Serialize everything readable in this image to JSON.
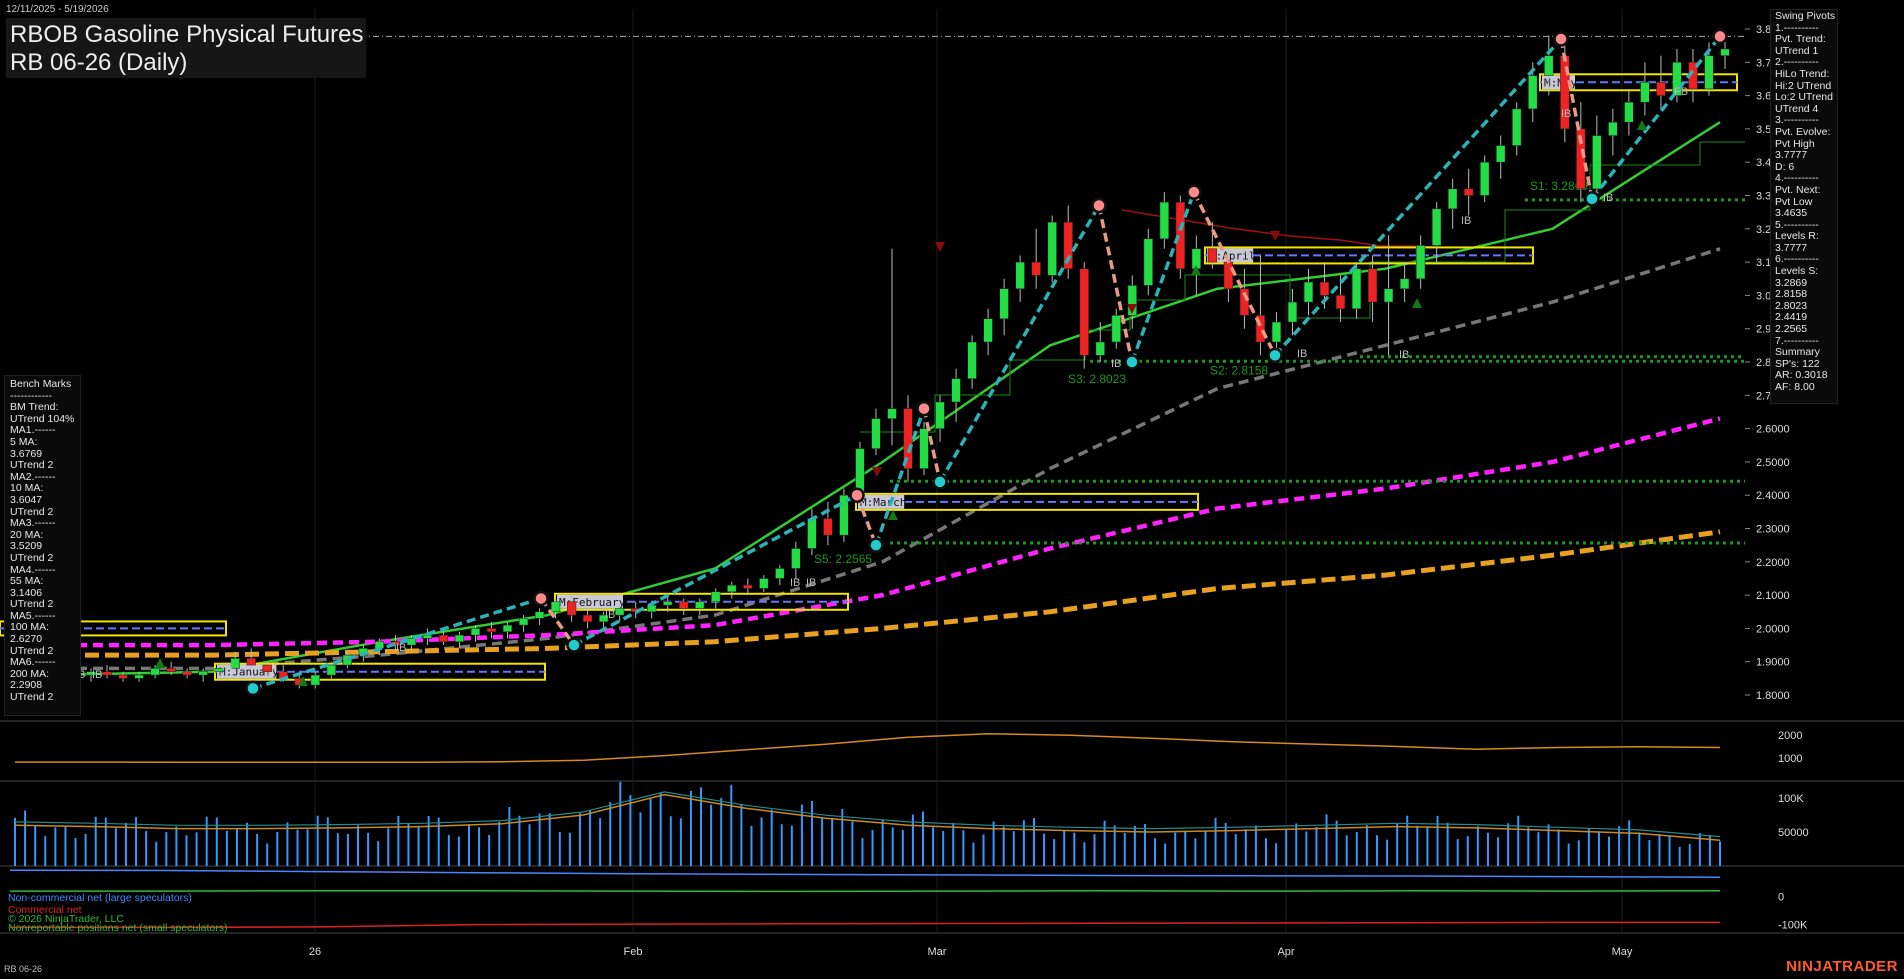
{
  "header": {
    "date_range": "12/11/2025 - 5/19/2026",
    "title": "RBOB Gasoline Physical Futures",
    "subtitle": "RB 06-26 (Daily)"
  },
  "benchmarks": [
    "Bench Marks",
    "------------",
    "BM Trend:",
    "UTrend 104%",
    "MA1.------",
    "5 MA:",
    "3.6769",
    "UTrend 2",
    "MA2.------",
    "10 MA:",
    "3.6047",
    "UTrend 2",
    "MA3.------",
    "20 MA:",
    "3.5209",
    "UTrend 2",
    "MA4.------",
    "55 MA:",
    "3.1406",
    "UTrend 2",
    "MA5.------",
    "100 MA:",
    "2.6270",
    "UTrend 2",
    "MA6.------",
    "200 MA:",
    "2.2908",
    "UTrend 2"
  ],
  "swing_pivots": [
    "Swing Pivots",
    "1.----------",
    "Pvt. Trend:",
    "UTrend 1",
    "2.----------",
    "HiLo Trend:",
    "Hi:2 UTrend",
    "Lo:2 UTrend",
    "UTrend 4",
    "3.----------",
    "Pvt. Evolve:",
    "Pvt High",
    "3.7777",
    "D: 6",
    "4.----------",
    "Pvt. Next:",
    "Pvt Low",
    "3.4635",
    "5.----------",
    "Levels R:",
    "3.7777",
    "6.----------",
    "Levels S:",
    "3.2869",
    "2.8158",
    "2.8023",
    "2.4419",
    "2.2565",
    "7.----------",
    "Summary",
    "SP's: 122",
    "AR: 0.3018",
    "AF: 8.00"
  ],
  "footer": {
    "symbol": "RB 06-26",
    "brand": "NINJATRADER",
    "cot_noncommercial": "Non-commercial net (large speculators)",
    "cot_commercial": "Commercial net",
    "cot_copyright": "© 2026 NinjaTrader, LLC",
    "cot_nonreportable": "Nonreportable positions net (small speculators)"
  },
  "colors": {
    "background": "#000000",
    "bull_candle": "#22dd44",
    "bear_candle": "#ee2222",
    "ma20": "#33cc33",
    "ma55": "#777777",
    "ma100": "#ff22ff",
    "ma200": "#e8a020",
    "swing_line_up": "#2ab3b8",
    "swing_line_down": "#e89a84",
    "support": "#1a9a1a",
    "volume": "#3399ff",
    "cot_noncommercial": "#4488ff",
    "cot_commercial": "#dd2222",
    "cot_nonreportable": "#33bb33",
    "brand": "#ff5a2a"
  },
  "chart_data": [
    {
      "type": "candlestick",
      "title": "RBOB Gasoline Physical Futures",
      "subtitle": "RB 06-26 (Daily)",
      "x_tick_labels": [
        "26",
        "Feb",
        "Mar",
        "Apr",
        "May"
      ],
      "y_tick_labels": [
        "3.8000",
        "3.7000",
        "3.6000",
        "3.5000",
        "3.4000",
        "3.3000",
        "3.2000",
        "3.1000",
        "3.0000",
        "2.9000",
        "2.8000",
        "2.7000",
        "2.6000",
        "2.5000",
        "2.4000",
        "2.3000",
        "2.2000",
        "2.1000",
        "2.0000",
        "1.9000",
        "1.8000"
      ],
      "ylim": [
        1.71,
        3.86
      ],
      "ohlc": [
        [
          1.87,
          1.88,
          1.85,
          1.86
        ],
        [
          1.86,
          1.88,
          1.84,
          1.87
        ],
        [
          1.87,
          1.89,
          1.85,
          1.86
        ],
        [
          1.86,
          1.87,
          1.84,
          1.85
        ],
        [
          1.85,
          1.87,
          1.84,
          1.86
        ],
        [
          1.86,
          1.89,
          1.85,
          1.88
        ],
        [
          1.88,
          1.9,
          1.86,
          1.87
        ],
        [
          1.87,
          1.88,
          1.85,
          1.86
        ],
        [
          1.86,
          1.88,
          1.84,
          1.87
        ],
        [
          1.87,
          1.89,
          1.86,
          1.88
        ],
        [
          1.88,
          1.93,
          1.87,
          1.91
        ],
        [
          1.91,
          1.94,
          1.88,
          1.89
        ],
        [
          1.89,
          1.9,
          1.86,
          1.87
        ],
        [
          1.87,
          1.89,
          1.84,
          1.85
        ],
        [
          1.85,
          1.86,
          1.82,
          1.83
        ],
        [
          1.83,
          1.87,
          1.82,
          1.86
        ],
        [
          1.86,
          1.9,
          1.85,
          1.89
        ],
        [
          1.89,
          1.93,
          1.88,
          1.92
        ],
        [
          1.92,
          1.95,
          1.9,
          1.94
        ],
        [
          1.94,
          1.97,
          1.92,
          1.96
        ],
        [
          1.96,
          1.98,
          1.93,
          1.95
        ],
        [
          1.95,
          1.98,
          1.93,
          1.97
        ],
        [
          1.97,
          2.0,
          1.95,
          1.98
        ],
        [
          1.98,
          2.0,
          1.95,
          1.96
        ],
        [
          1.96,
          1.99,
          1.94,
          1.98
        ],
        [
          1.98,
          2.01,
          1.96,
          2.0
        ],
        [
          2.0,
          2.02,
          1.97,
          1.99
        ],
        [
          1.99,
          2.02,
          1.97,
          2.01
        ],
        [
          2.01,
          2.04,
          1.99,
          2.03
        ],
        [
          2.03,
          2.06,
          2.01,
          2.05
        ],
        [
          2.05,
          2.09,
          2.03,
          2.08
        ],
        [
          2.08,
          2.1,
          2.02,
          2.04
        ],
        [
          2.04,
          2.06,
          2.0,
          2.02
        ],
        [
          2.02,
          2.05,
          2.0,
          2.04
        ],
        [
          2.04,
          2.07,
          2.02,
          2.06
        ],
        [
          2.06,
          2.08,
          2.03,
          2.05
        ],
        [
          2.05,
          2.08,
          2.03,
          2.07
        ],
        [
          2.07,
          2.1,
          2.05,
          2.08
        ],
        [
          2.08,
          2.09,
          2.04,
          2.06
        ],
        [
          2.06,
          2.09,
          2.04,
          2.08
        ],
        [
          2.08,
          2.12,
          2.06,
          2.11
        ],
        [
          2.11,
          2.14,
          2.09,
          2.13
        ],
        [
          2.13,
          2.15,
          2.1,
          2.12
        ],
        [
          2.12,
          2.16,
          2.11,
          2.15
        ],
        [
          2.15,
          2.19,
          2.13,
          2.18
        ],
        [
          2.18,
          2.26,
          2.15,
          2.24
        ],
        [
          2.24,
          2.36,
          2.22,
          2.33
        ],
        [
          2.33,
          2.38,
          2.25,
          2.28
        ],
        [
          2.28,
          2.42,
          2.26,
          2.4
        ],
        [
          2.4,
          2.56,
          2.38,
          2.54
        ],
        [
          2.54,
          2.66,
          2.52,
          2.63
        ],
        [
          2.63,
          3.14,
          2.55,
          2.66
        ],
        [
          2.66,
          2.7,
          2.44,
          2.48
        ],
        [
          2.48,
          2.62,
          2.46,
          2.6
        ],
        [
          2.6,
          2.7,
          2.56,
          2.68
        ],
        [
          2.68,
          2.78,
          2.62,
          2.75
        ],
        [
          2.75,
          2.88,
          2.72,
          2.86
        ],
        [
          2.86,
          2.96,
          2.82,
          2.93
        ],
        [
          2.93,
          3.05,
          2.88,
          3.02
        ],
        [
          3.02,
          3.12,
          2.98,
          3.1
        ],
        [
          3.1,
          3.2,
          3.02,
          3.06
        ],
        [
          3.06,
          3.24,
          3.04,
          3.22
        ],
        [
          3.22,
          3.27,
          3.05,
          3.08
        ],
        [
          3.08,
          3.1,
          2.78,
          2.82
        ],
        [
          2.82,
          2.92,
          2.8,
          2.86
        ],
        [
          2.86,
          2.96,
          2.84,
          2.94
        ],
        [
          2.94,
          3.06,
          2.9,
          3.03
        ],
        [
          3.03,
          3.2,
          3.0,
          3.17
        ],
        [
          3.17,
          3.31,
          3.14,
          3.28
        ],
        [
          3.28,
          3.3,
          3.05,
          3.08
        ],
        [
          3.08,
          3.18,
          3.0,
          3.14
        ],
        [
          3.14,
          3.22,
          3.08,
          3.1
        ],
        [
          3.1,
          3.14,
          2.98,
          3.02
        ],
        [
          3.02,
          3.08,
          2.9,
          2.94
        ],
        [
          2.94,
          3.12,
          2.82,
          2.86
        ],
        [
          2.86,
          2.95,
          2.82,
          2.92
        ],
        [
          2.92,
          3.02,
          2.88,
          2.98
        ],
        [
          2.98,
          3.08,
          2.94,
          3.04
        ],
        [
          3.04,
          3.1,
          2.96,
          3.0
        ],
        [
          3.0,
          3.06,
          2.92,
          2.96
        ],
        [
          2.96,
          3.1,
          2.93,
          3.08
        ],
        [
          3.08,
          3.12,
          2.92,
          2.98
        ],
        [
          2.98,
          3.18,
          2.82,
          3.02
        ],
        [
          3.02,
          3.1,
          2.98,
          3.05
        ],
        [
          3.05,
          3.18,
          3.02,
          3.15
        ],
        [
          3.15,
          3.28,
          3.1,
          3.26
        ],
        [
          3.26,
          3.35,
          3.2,
          3.32
        ],
        [
          3.32,
          3.38,
          3.24,
          3.3
        ],
        [
          3.3,
          3.42,
          3.28,
          3.4
        ],
        [
          3.4,
          3.48,
          3.35,
          3.45
        ],
        [
          3.45,
          3.58,
          3.42,
          3.56
        ],
        [
          3.56,
          3.7,
          3.52,
          3.66
        ],
        [
          3.66,
          3.78,
          3.6,
          3.72
        ],
        [
          3.72,
          3.76,
          3.46,
          3.5
        ],
        [
          3.5,
          3.58,
          3.28,
          3.32
        ],
        [
          3.32,
          3.54,
          3.3,
          3.48
        ],
        [
          3.48,
          3.56,
          3.42,
          3.52
        ],
        [
          3.52,
          3.62,
          3.48,
          3.58
        ],
        [
          3.58,
          3.7,
          3.54,
          3.64
        ],
        [
          3.64,
          3.72,
          3.56,
          3.6
        ],
        [
          3.6,
          3.74,
          3.58,
          3.7
        ],
        [
          3.7,
          3.74,
          3.58,
          3.62
        ],
        [
          3.62,
          3.76,
          3.6,
          3.72
        ],
        [
          3.72,
          3.78,
          3.68,
          3.74
        ]
      ],
      "moving_averages": [
        {
          "name": "20 MA",
          "values": [
            1.86,
            1.87,
            1.96,
            2.04,
            2.18,
            2.5,
            2.85,
            3.02,
            3.08,
            3.2,
            3.52
          ]
        },
        {
          "name": "55 MA",
          "values": [
            1.88,
            1.88,
            1.92,
            1.97,
            2.04,
            2.2,
            2.48,
            2.72,
            2.85,
            2.98,
            3.14
          ]
        },
        {
          "name": "100 MA",
          "values": [
            1.95,
            1.95,
            1.96,
            1.98,
            2.01,
            2.1,
            2.24,
            2.36,
            2.42,
            2.5,
            2.63
          ]
        },
        {
          "name": "200 MA",
          "values": [
            1.92,
            1.92,
            1.93,
            1.94,
            1.96,
            2.0,
            2.05,
            2.12,
            2.16,
            2.22,
            2.29
          ]
        }
      ],
      "support_levels": [
        {
          "label": "S1: 3.2869",
          "value": 3.2869
        },
        {
          "label": "S2: 2.8158",
          "value": 2.8158
        },
        {
          "label": "S3: 2.8023",
          "value": 2.8023
        },
        {
          "label": "S4: 2.4419",
          "value": 2.4419
        },
        {
          "label": "S5: 2.2565",
          "value": 2.2565
        }
      ],
      "resistance_level": 3.7777,
      "monthly_boxes": [
        {
          "label": "M:January",
          "value": 1.87
        },
        {
          "label": "M:February",
          "value": 2.08
        },
        {
          "label": "M:March",
          "value": 2.38
        },
        {
          "label": "M:April",
          "value": 3.12
        },
        {
          "label": "M:May",
          "value": 3.64
        }
      ],
      "swing_pivots": [
        {
          "type": "low",
          "value": 1.82
        },
        {
          "type": "high",
          "value": 2.09
        },
        {
          "type": "low",
          "value": 1.95
        },
        {
          "type": "high",
          "value": 2.4
        },
        {
          "type": "low",
          "value": 2.25
        },
        {
          "type": "high",
          "value": 2.66
        },
        {
          "type": "low",
          "value": 2.44
        },
        {
          "type": "high",
          "value": 3.27
        },
        {
          "type": "low",
          "value": 2.8
        },
        {
          "type": "high",
          "value": 3.31
        },
        {
          "type": "low",
          "value": 2.82
        },
        {
          "type": "high",
          "value": 3.77
        },
        {
          "type": "low",
          "value": 3.29
        },
        {
          "type": "high",
          "value": 3.7777
        }
      ],
      "text_markers": [
        "IB",
        "IB",
        "IB",
        "IB",
        "IB",
        "IB",
        "IB",
        "IB",
        "IB",
        "IB",
        "IB",
        "IB",
        "FB",
        "IB"
      ]
    },
    {
      "type": "line",
      "name": "Open interest",
      "y_tick_labels": [
        "2000",
        "1000"
      ],
      "ylim": [
        0,
        2600
      ],
      "values": [
        820,
        820,
        815,
        810,
        810,
        815,
        830,
        900,
        1100,
        1350,
        1600,
        1900,
        2050,
        1980,
        1850,
        1700,
        1600,
        1500,
        1380,
        1450,
        1480,
        1450
      ]
    },
    {
      "type": "bar",
      "name": "Volume",
      "y_tick_labels": [
        "100K",
        "50000"
      ],
      "ylim": [
        0,
        125000
      ],
      "average_line": [
        60000,
        58000,
        55000,
        55000,
        56000,
        58000,
        62000,
        75000,
        105000,
        85000,
        70000,
        60000,
        55000,
        52000,
        50000,
        52000,
        55000,
        58000,
        56000,
        52000,
        48000,
        38000
      ]
    },
    {
      "type": "line",
      "name": "COT",
      "y_tick_labels": [
        "0",
        "-100K"
      ],
      "series": [
        {
          "name": "Non-commercial net (large speculators)",
          "values": [
            95000,
            94000,
            90000,
            86000,
            82000,
            80000,
            78000,
            76000,
            75000,
            74000,
            72000,
            70000
          ]
        },
        {
          "name": "Commercial net",
          "values": [
            -110000,
            -110000,
            -108000,
            -100000,
            -98000,
            -97000,
            -96000,
            -95000,
            -94000,
            -93000,
            -92000,
            -92000
          ]
        },
        {
          "name": "Nonreportable positions net (small speculators)",
          "values": [
            20000,
            20000,
            21000,
            21000,
            20000,
            19000,
            20000,
            21000,
            20000,
            21000,
            20000,
            21000
          ]
        }
      ]
    }
  ]
}
